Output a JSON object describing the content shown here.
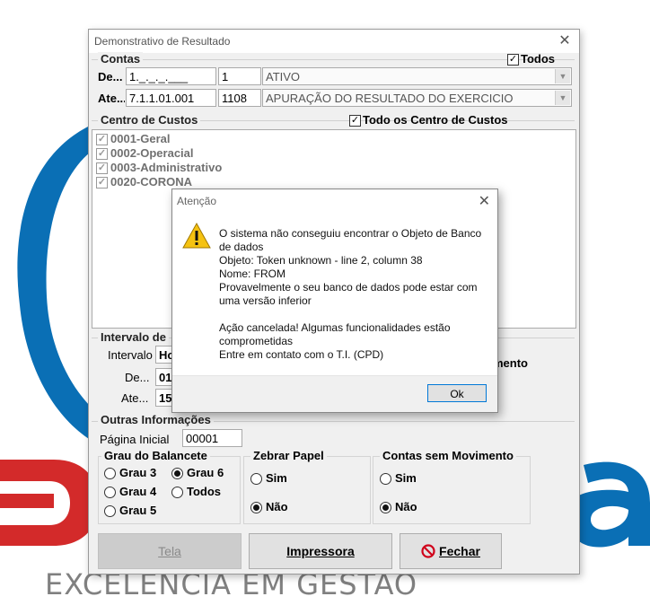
{
  "background": {
    "tagline": "EXCELENCIA EM GESTAO",
    "brand_colors": {
      "blue": "#0a6fb5",
      "red": "#d32a2a"
    }
  },
  "window": {
    "title": "Demonstrativo de Resultado",
    "contas": {
      "section_title": "Contas",
      "todos_label": "Todos",
      "todos_checked": true,
      "de_label": "De...",
      "ate_label": "Ate...",
      "de_code": "1._._._.___",
      "de_num": "1",
      "de_desc": "ATIVO",
      "ate_code": "7.1.1.01.001",
      "ate_num": "1108",
      "ate_desc": "APURAÇÃO DO RESULTADO DO EXERCICIO"
    },
    "centro_custos": {
      "section_title": "Centro de Custos",
      "todos_label": "Todo os Centro de Custos",
      "todos_checked": true,
      "items": [
        {
          "label": "0001-Geral",
          "checked": true
        },
        {
          "label": "0002-Operacial",
          "checked": true
        },
        {
          "label": "0003-Administrativo",
          "checked": true
        },
        {
          "label": "0020-CORONA",
          "checked": true
        }
      ]
    },
    "intervalo": {
      "section_title": "Intervalo de",
      "intervalo_label": "Intervalo",
      "intervalo_value": "Ho",
      "de_label": "De...",
      "de_value": "01/",
      "ate_label": "Ate...",
      "ate_value": "15/",
      "hidden_right_text": "mento"
    },
    "outras": {
      "section_title": "Outras Informações",
      "pagina_label": "Página Inicial",
      "pagina_value": "00001",
      "grau": {
        "title": "Grau do Balancete",
        "options": [
          {
            "label": "Grau 3",
            "selected": false
          },
          {
            "label": "Grau 6",
            "selected": true
          },
          {
            "label": "Grau 4",
            "selected": false
          },
          {
            "label": "Todos",
            "selected": false
          },
          {
            "label": "Grau 5",
            "selected": false
          }
        ]
      },
      "zebrar": {
        "title": "Zebrar Papel",
        "options": [
          {
            "label": "Sim",
            "selected": false
          },
          {
            "label": "Não",
            "selected": true
          }
        ]
      },
      "contas_sem_mov": {
        "title": "Contas sem Movimento",
        "options": [
          {
            "label": "Sim",
            "selected": false
          },
          {
            "label": "Não",
            "selected": true
          }
        ]
      }
    },
    "buttons": {
      "tela": "Tela",
      "impressora": "Impressora",
      "fechar": "Fechar"
    }
  },
  "alert": {
    "title": "Atenção",
    "icon": "warning-icon",
    "lines": [
      "O sistema não conseguiu encontrar o Objeto de Banco",
      "de dados",
      "Objeto: Token unknown - line 2, column 38",
      "Nome: FROM",
      "Provavelmente o seu banco de dados pode estar com",
      "uma versão inferior",
      "",
      "Ação cancelada! Algumas funcionalidades estão",
      "comprometidas",
      "Entre em contato com o T.I. (CPD)"
    ],
    "ok_label": "Ok"
  }
}
